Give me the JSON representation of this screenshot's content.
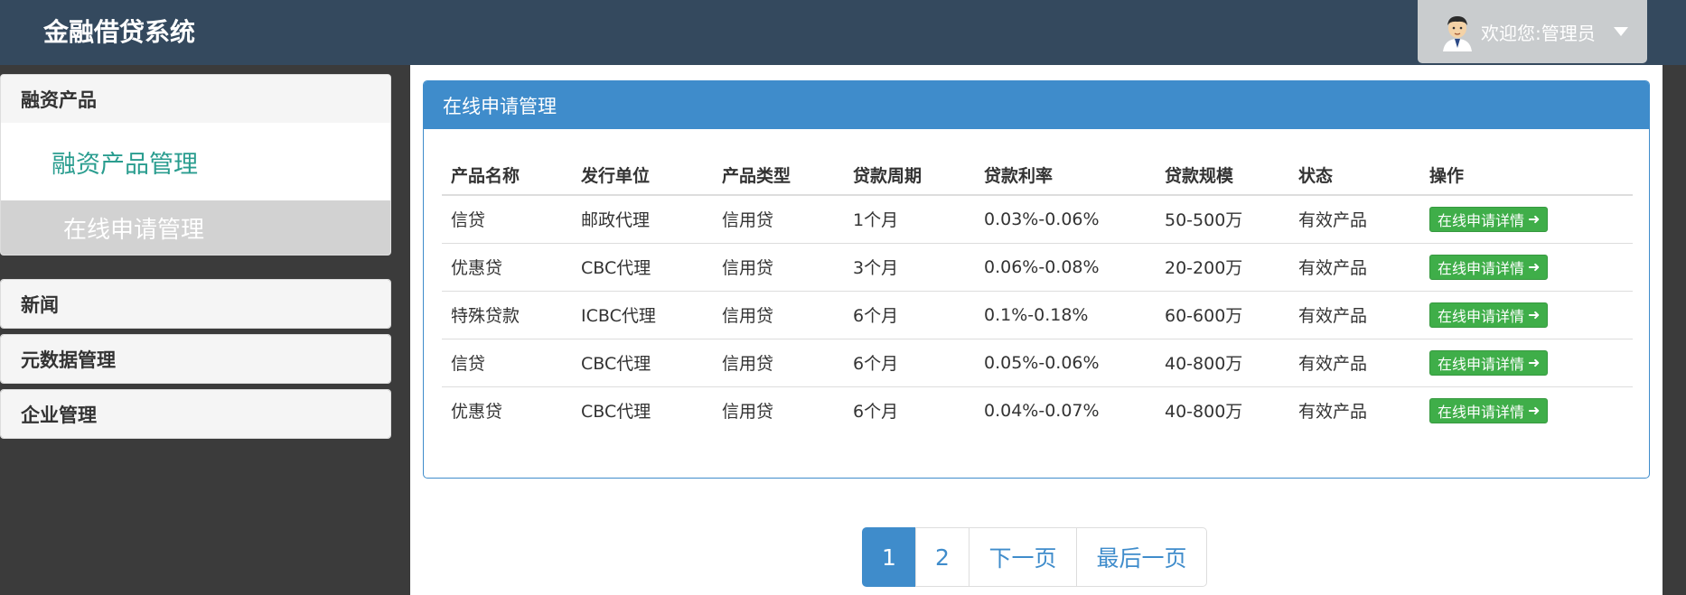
{
  "header": {
    "brand": "金融借贷系统",
    "welcome": "欢迎您:管理员"
  },
  "sidebar": {
    "groups": [
      {
        "title": "融资产品",
        "items": [
          {
            "label": "融资产品管理"
          },
          {
            "label": "在线申请管理",
            "active": true
          }
        ]
      },
      {
        "title": "新闻"
      },
      {
        "title": "元数据管理"
      },
      {
        "title": "企业管理"
      }
    ]
  },
  "main": {
    "card_title": "在线申请管理",
    "columns": [
      "产品名称",
      "发行单位",
      "产品类型",
      "贷款周期",
      "贷款利率",
      "贷款规模",
      "状态",
      "操作"
    ],
    "rows": [
      [
        "信贷",
        "邮政代理",
        "信用贷",
        "1个月",
        "0.03%-0.06%",
        "50-500万",
        "有效产品"
      ],
      [
        "优惠贷",
        "CBC代理",
        "信用贷",
        "3个月",
        "0.06%-0.08%",
        "20-200万",
        "有效产品"
      ],
      [
        "特殊贷款",
        "ICBC代理",
        "信用贷",
        "6个月",
        "0.1%-0.18%",
        "60-600万",
        "有效产品"
      ],
      [
        "信贷",
        "CBC代理",
        "信用贷",
        "6个月",
        "0.05%-0.06%",
        "40-800万",
        "有效产品"
      ],
      [
        "优惠贷",
        "CBC代理",
        "信用贷",
        "6个月",
        "0.04%-0.07%",
        "40-800万",
        "有效产品"
      ]
    ],
    "action_label": "在线申请详情"
  },
  "pagination": {
    "pages": [
      "1",
      "2"
    ],
    "current": "1",
    "next": "下一页",
    "last": "最后一页"
  },
  "colors": {
    "topbar": "#34495e",
    "primary": "#3f8ccb",
    "success": "#3fae49",
    "link": "#2a9d8f"
  },
  "icons": {
    "avatar": "user-avatar-icon",
    "caret": "caret-down-icon",
    "action_arrow": "arrow-right-icon"
  }
}
